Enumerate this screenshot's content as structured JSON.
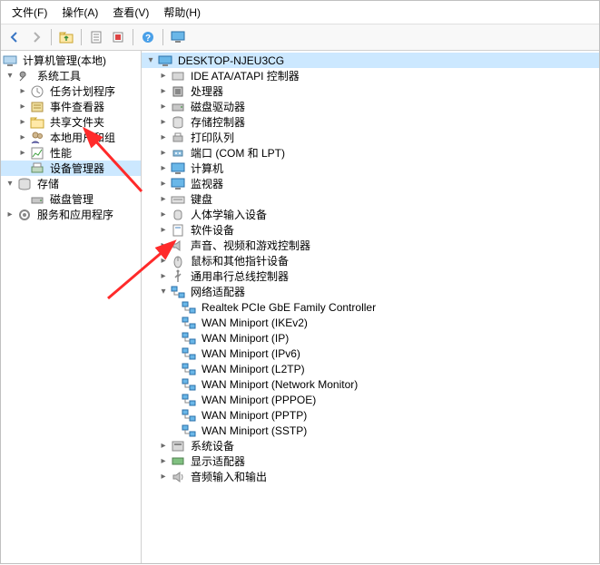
{
  "menu": {
    "file": "文件(F)",
    "action": "操作(A)",
    "view": "查看(V)",
    "help": "帮助(H)"
  },
  "toolbar": {
    "back": "back",
    "forward": "forward",
    "up": "up",
    "properties": "properties",
    "delete": "delete",
    "refresh": "refresh",
    "help": "help",
    "monitor": "monitor"
  },
  "left_tree": {
    "root": "计算机管理(本地)",
    "system_tools": "系统工具",
    "task_scheduler": "任务计划程序",
    "event_viewer": "事件查看器",
    "shared_folders": "共享文件夹",
    "local_users": "本地用户和组",
    "performance": "性能",
    "device_manager": "设备管理器",
    "storage": "存储",
    "disk_mgmt": "磁盘管理",
    "services_apps": "服务和应用程序"
  },
  "right_tree": {
    "root": "DESKTOP-NJEU3CG",
    "categories": [
      "IDE ATA/ATAPI 控制器",
      "处理器",
      "磁盘驱动器",
      "存储控制器",
      "打印队列",
      "端口 (COM 和 LPT)",
      "计算机",
      "监视器",
      "键盘",
      "人体学输入设备",
      "软件设备",
      "声音、视频和游戏控制器",
      "鼠标和其他指针设备",
      "通用串行总线控制器",
      "网络适配器",
      "系统设备",
      "显示适配器",
      "音频输入和输出"
    ],
    "network_adapters": [
      "Realtek PCIe GbE Family Controller",
      "WAN Miniport (IKEv2)",
      "WAN Miniport (IP)",
      "WAN Miniport (IPv6)",
      "WAN Miniport (L2TP)",
      "WAN Miniport (Network Monitor)",
      "WAN Miniport (PPPOE)",
      "WAN Miniport (PPTP)",
      "WAN Miniport (SSTP)"
    ]
  }
}
